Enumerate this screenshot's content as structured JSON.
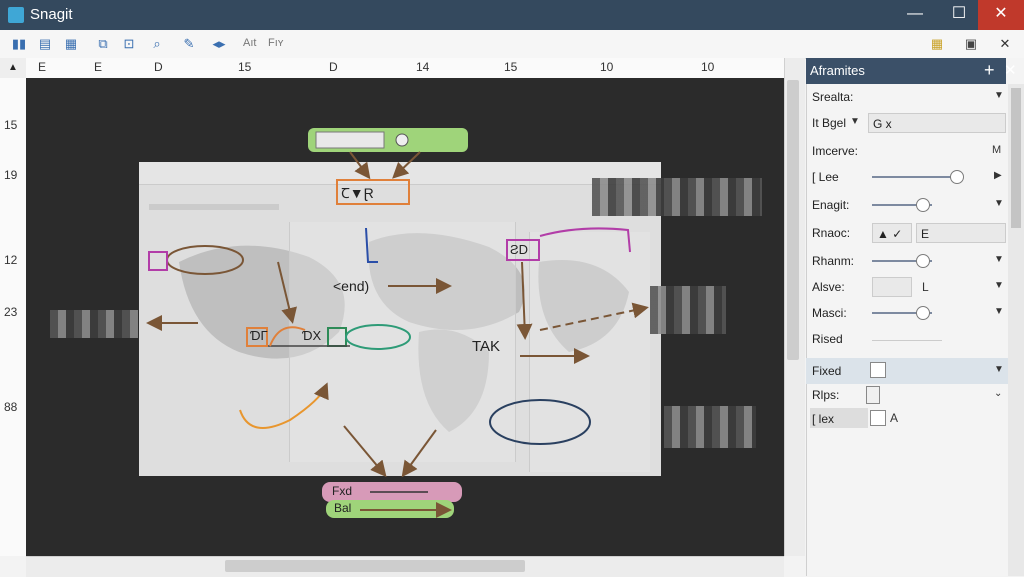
{
  "window": {
    "title": "Snagit"
  },
  "titlebar_buttons": {
    "minimize": "—",
    "maximize": "☐",
    "close": "✕"
  },
  "toolbar": {
    "icons": [
      "copy-icon",
      "folder-icon",
      "layers-icon",
      "zoom-icon",
      "crop-icon",
      "search-icon",
      "pen-icon",
      "move-icon"
    ],
    "text1": "Aıt",
    "text2": "Fıʏ",
    "right_close": "✕"
  },
  "ruler_top": [
    "E",
    "E",
    "D",
    "15",
    "D",
    "14",
    "15",
    "10",
    "10"
  ],
  "ruler_left": [
    "15",
    "19",
    "12",
    "23",
    "88"
  ],
  "canvas": {
    "labels": {
      "send": "<end)",
      "tag1": "ƧD",
      "tag2": "Ꞇ▼Ɽ",
      "tag3": "ƊΓ",
      "tag4": "ƊX",
      "tag5": "TAK",
      "pill1": "Fxd",
      "pill2": "Bal"
    }
  },
  "panel": {
    "title": "Aframites",
    "plus": "+",
    "close": "✕",
    "rows": [
      {
        "label": "Srealta:",
        "value": ""
      },
      {
        "label": "It Bgel",
        "value": "G x"
      },
      {
        "label": "Imcerve:",
        "value": "M"
      },
      {
        "label": "[ Lee",
        "value": ""
      },
      {
        "label": "Enagit:",
        "value": ""
      },
      {
        "label": "Rnaoc:",
        "value": "E"
      },
      {
        "label": "Rhanm:",
        "value": ""
      },
      {
        "label": "Alsve:",
        "value": "L"
      },
      {
        "label": "Masci:",
        "value": ""
      },
      {
        "label": "Rised",
        "value": ""
      },
      {
        "label": "Fixed",
        "value": ""
      },
      {
        "label": "Rlps:",
        "value": ""
      },
      {
        "label": "[ lex",
        "value": "A"
      }
    ]
  }
}
